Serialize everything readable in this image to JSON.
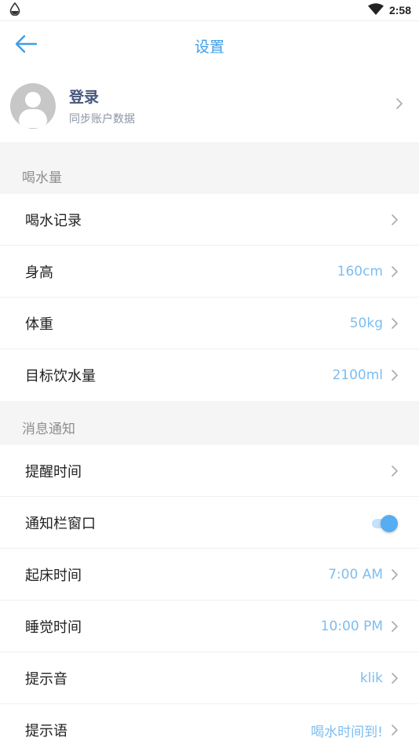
{
  "status_bar": {
    "time": "2:58",
    "icons": [
      "water-drop-icon",
      "wifi-icon"
    ]
  },
  "app_bar": {
    "title": "设置",
    "back_icon": "arrow-left-icon"
  },
  "account": {
    "name": "登录",
    "subtitle": "同步账户数据"
  },
  "sections": [
    {
      "header": "喝水量",
      "rows": [
        {
          "label": "喝水记录",
          "value": ""
        },
        {
          "label": "身高",
          "value": "160cm"
        },
        {
          "label": "体重",
          "value": "50kg"
        },
        {
          "label": "目标饮水量",
          "value": "2100ml"
        }
      ]
    },
    {
      "header": "消息通知",
      "rows": [
        {
          "label": "提醒时间",
          "value": ""
        },
        {
          "label": "通知栏窗口",
          "toggle": true
        },
        {
          "label": "起床时间",
          "value": "7:00 AM"
        },
        {
          "label": "睡觉时间",
          "value": "10:00 PM"
        },
        {
          "label": "提示音",
          "value": "klik"
        },
        {
          "label": "提示语",
          "value": "喝水时间到!"
        }
      ]
    }
  ],
  "colors": {
    "accent": "#3d9ee8",
    "value_text": "#7dbdf0",
    "section_bg": "#f5f5f5",
    "toggle_on": "#56adf2"
  }
}
